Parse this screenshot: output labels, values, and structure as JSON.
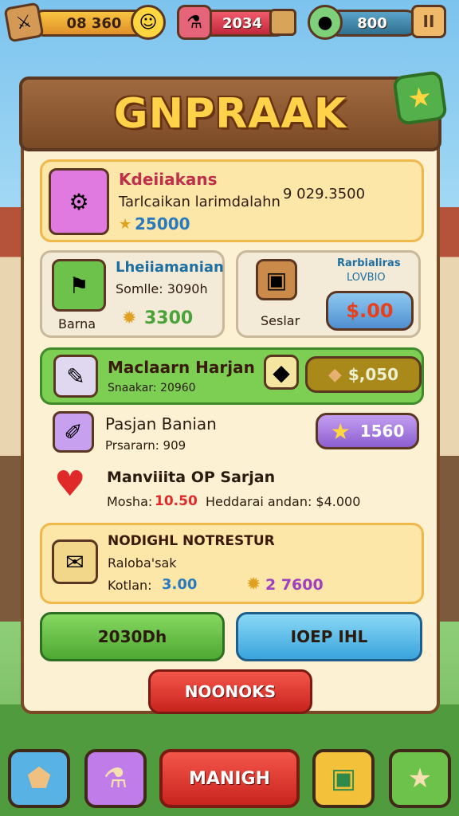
{
  "topbar": {
    "gold": "08 360",
    "gems": "2034",
    "energy": "800",
    "pause": "II"
  },
  "panel": {
    "title": "GNPRAAK"
  },
  "card1": {
    "title": "Kdeiiakans",
    "subtitle": "Tarlcaikan larimdalahn",
    "price": "9 029.3500",
    "reward": "25000"
  },
  "card2": {
    "title": "Lheiiamanian",
    "subtitle": "Somlle: 3090h",
    "tag": "Barna",
    "reward": "3300"
  },
  "card3": {
    "title": "Rarbialiras",
    "subtitle": "LOVBIO",
    "tag": "Seslar",
    "price": "$.00"
  },
  "card4": {
    "title": "Maclaarn Harjan",
    "subtitle": "Snaakar: 20960",
    "price": "$,050"
  },
  "row5": {
    "title": "Pasjan Banian",
    "subtitle": "Prsararn: 909",
    "price": "1560"
  },
  "row6": {
    "title": "Manviiita OP Sarjan",
    "stat1_label": "Mosha:",
    "stat1_value": "10.50",
    "stat2": "Heddarai andan: $4.000"
  },
  "card7": {
    "title": "NODIGHL NOTRESTUR",
    "subtitle": "Raloba'sak",
    "label": "Kotlan:",
    "value": "3.00",
    "reward": "2 7600"
  },
  "actions": {
    "left": "2030Dh",
    "right": "IOEP IHL",
    "center": "NOONOKS"
  },
  "bottom": {
    "main": "MANIGH"
  },
  "colors": {
    "wood": "#7a4a26",
    "parchment": "#fdf1d4",
    "green": "#6cc24a",
    "blue": "#4fb8e6",
    "red": "#e2403c",
    "purple": "#a77ee0"
  }
}
